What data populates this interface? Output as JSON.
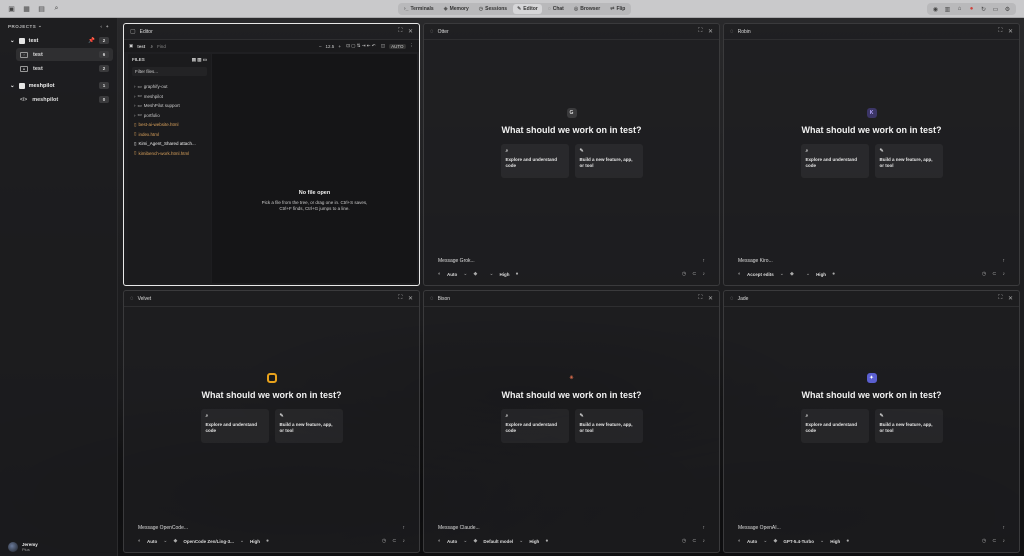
{
  "topbar": {
    "tabs": [
      {
        "label": "Terminals",
        "icon": "terminal-icon"
      },
      {
        "label": "Memory",
        "icon": "memory-icon"
      },
      {
        "label": "Sessions",
        "icon": "sessions-icon"
      },
      {
        "label": "Editor",
        "icon": "editor-icon",
        "active": true
      },
      {
        "label": "Chat",
        "icon": "chat-icon"
      },
      {
        "label": "Browser",
        "icon": "browser-icon"
      },
      {
        "label": "Flip",
        "icon": "flip-icon"
      }
    ]
  },
  "sidebar": {
    "header": "PROJECTS",
    "projects": [
      {
        "name": "test",
        "count": "2",
        "items": [
          {
            "label": "test",
            "count": "6",
            "selected": true
          },
          {
            "label": "test",
            "count": "2"
          }
        ]
      },
      {
        "name": "meshpilot",
        "count": "1",
        "items": [
          {
            "label": "meshpilot",
            "count": "0"
          }
        ]
      }
    ],
    "user": {
      "name": "Jeremy",
      "plan": "Plus"
    }
  },
  "editor": {
    "title": "Editor",
    "project": "test",
    "find_placeholder": "Find",
    "font_size": "12.5",
    "auto": "AUTO",
    "files_header": "FILES",
    "filter_placeholder": "Filter files...",
    "files": [
      {
        "name": "graphify-out",
        "type": "folder"
      },
      {
        "name": "meshpilot",
        "type": "folder"
      },
      {
        "name": "MeshPilot support",
        "type": "folder"
      },
      {
        "name": "portfolio",
        "type": "folder"
      },
      {
        "name": "best-ai-website.html",
        "type": "orange"
      },
      {
        "name": "index.html",
        "type": "orange"
      },
      {
        "name": "Kimi_Agent_Shared attach...",
        "type": "white"
      },
      {
        "name": "kimibench-work.html.html",
        "type": "orange"
      }
    ],
    "nofile_title": "No file open",
    "nofile_line1": "Pick a file from the tree, or drag one in. Ctrl+S saves,",
    "nofile_line2": "Ctrl+F finds, Ctrl+G jumps to a line."
  },
  "chat": {
    "question": "What should we work on in test?",
    "card1": "Explore and understand code",
    "card2": "Build a new feature, app, or tool"
  },
  "panes": [
    {
      "name": "Otter",
      "badge": "G",
      "badge_bg": "#3a3a3c",
      "badge_fg": "#ddd",
      "placeholder": "Message Grok...",
      "opt1": "Auto",
      "opt2": "",
      "opt3": "High"
    },
    {
      "name": "Robin",
      "badge": "K",
      "badge_bg": "#3b3566",
      "badge_fg": "#b7a8ff",
      "placeholder": "Message Kiro...",
      "opt1": "Accept edits",
      "opt2": "",
      "opt3": "High"
    },
    {
      "name": "Velvet",
      "badge": "",
      "badge_bg": "#e8a21c",
      "badge_fg": "#111",
      "placeholder": "Message OpenCode...",
      "opt1": "Auto",
      "opt2": "OpenCode Zen/Ling-3...",
      "opt3": "High"
    },
    {
      "name": "Bison",
      "badge": "✳",
      "badge_bg": "transparent",
      "badge_fg": "#e2704e",
      "placeholder": "Message Claude...",
      "opt1": "Auto",
      "opt2": "Default model",
      "opt3": "High"
    },
    {
      "name": "Jade",
      "badge": "✦",
      "badge_bg": "#5a5fd0",
      "badge_fg": "#fff",
      "placeholder": "Message OpenAI...",
      "opt1": "Auto",
      "opt2": "GPT-5.4-Turbo",
      "opt3": "High"
    }
  ]
}
